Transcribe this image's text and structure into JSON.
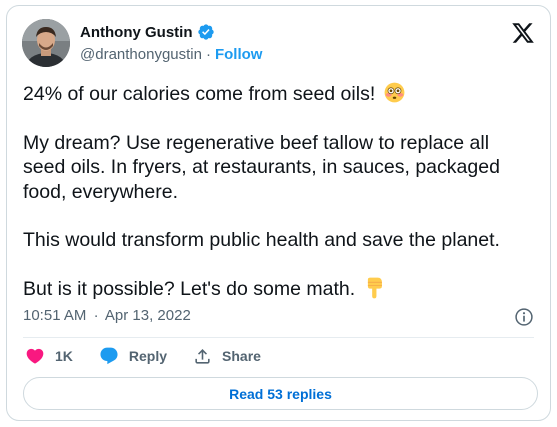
{
  "author": {
    "name": "Anthony Gustin",
    "handle": "@dranthonygustin",
    "separator": "·",
    "follow_label": "Follow"
  },
  "tweet": {
    "paragraphs": [
      "24% of our calories come from seed oils!",
      "My dream? Use regenerative beef tallow to replace all seed oils. In fryers, at restaurants, in sauces, packaged food, everywhere.",
      "This would transform public health and save the planet.",
      "But is it possible? Let's do some math."
    ],
    "emojis": [
      "flushed-face",
      "backhand-index-pointing-down"
    ]
  },
  "meta": {
    "time": "10:51 AM",
    "separator": "·",
    "date": "Apr 13, 2022"
  },
  "actions": {
    "like_count": "1K",
    "reply_label": "Reply",
    "share_label": "Share"
  },
  "read_replies_label": "Read 53 replies",
  "icons": {
    "verified": "verified-badge-icon",
    "logo": "x-logo-icon",
    "info": "info-icon",
    "like": "heart-icon",
    "reply": "speech-bubble-icon",
    "share": "share-upload-icon"
  },
  "colors": {
    "accent": "#1d9bf0",
    "like": "#f91880",
    "text": "#0f1419",
    "muted": "#536471",
    "border": "#cfd9de",
    "link": "#006fd6"
  }
}
